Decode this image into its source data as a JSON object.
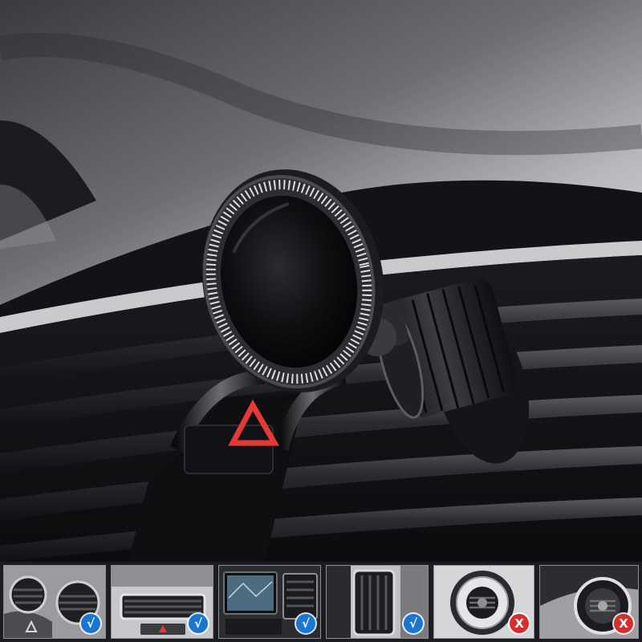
{
  "colors": {
    "ok": "#1976d2",
    "bad": "#d32f2f",
    "hazard": "#e53935"
  },
  "thumbnails": [
    {
      "vent": "round-vents",
      "status": "compatible",
      "mark": "√"
    },
    {
      "vent": "horizontal-slot-vent",
      "status": "compatible",
      "mark": "√"
    },
    {
      "vent": "vent-beside-screen",
      "status": "compatible",
      "mark": "√"
    },
    {
      "vent": "vertical-vent",
      "status": "compatible",
      "mark": "√"
    },
    {
      "vent": "spherical-vent",
      "status": "incompatible",
      "mark": "X"
    },
    {
      "vent": "spherical-vent-ring",
      "status": "incompatible",
      "mark": "X"
    }
  ]
}
